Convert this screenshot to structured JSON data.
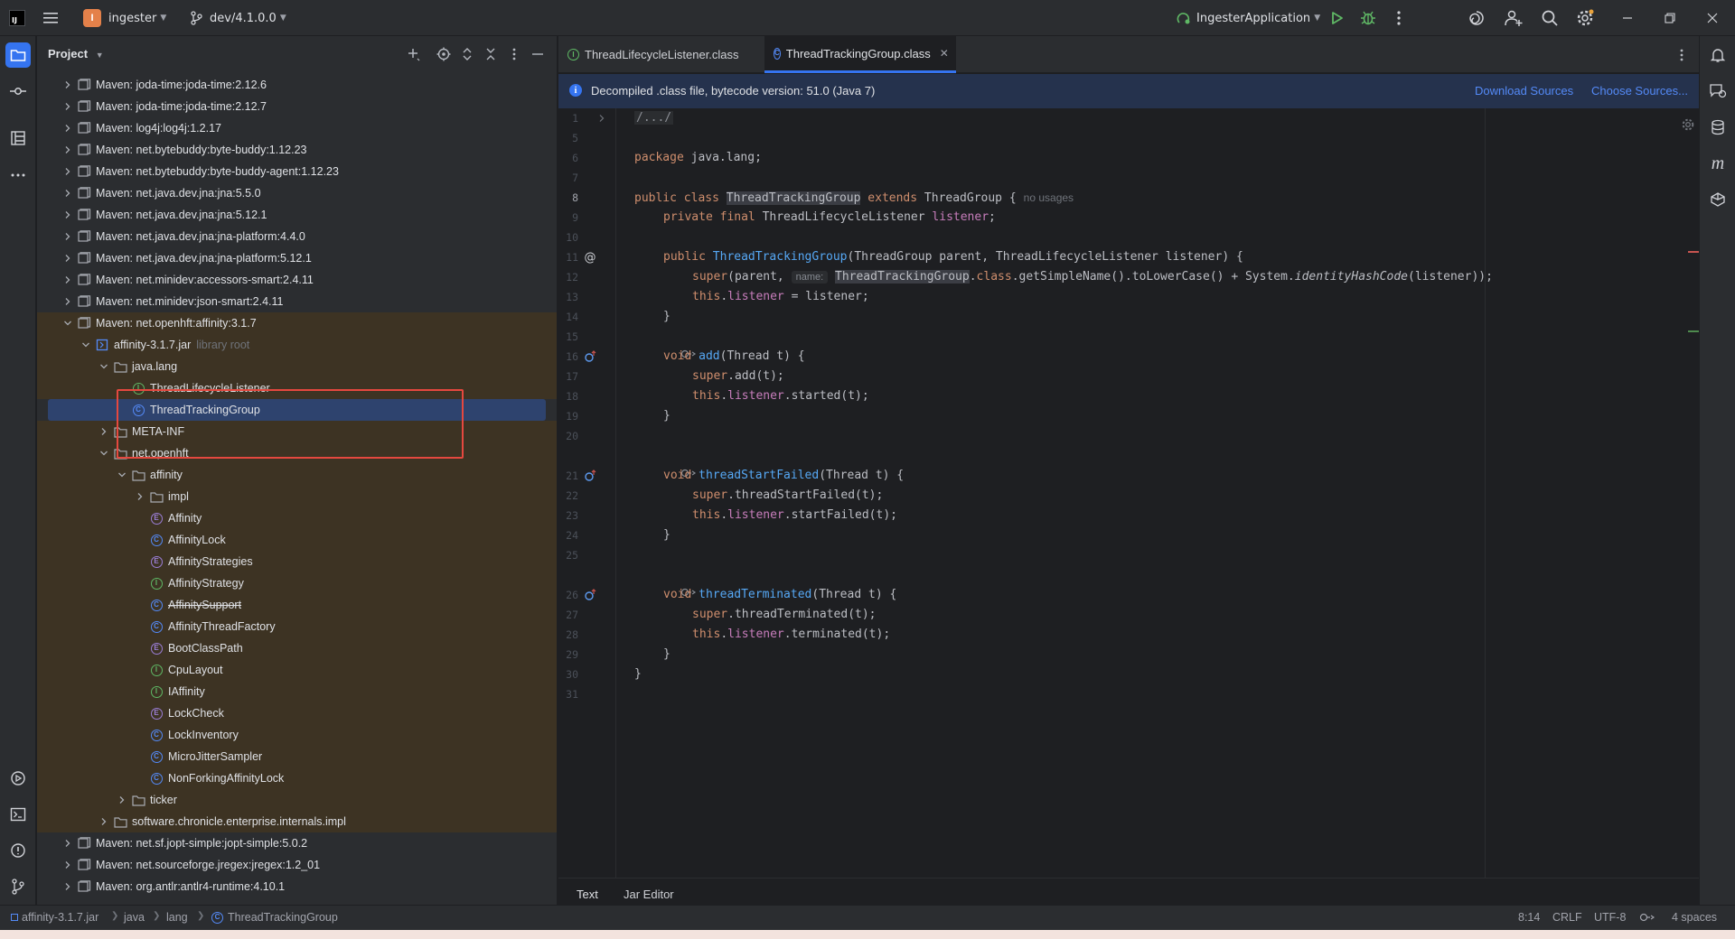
{
  "titlebar": {
    "project_badge": "I",
    "project_name": "ingester",
    "branch": "dev/4.1.0.0",
    "run_config": "IngesterApplication"
  },
  "project_panel": {
    "title": "Project",
    "tree": [
      {
        "label": "Maven: joda-time:joda-time:2.12.6",
        "icon": "library-icon",
        "depth": 0,
        "arrow": "collapsed"
      },
      {
        "label": "Maven: joda-time:joda-time:2.12.7",
        "icon": "library-icon",
        "depth": 0,
        "arrow": "collapsed"
      },
      {
        "label": "Maven: log4j:log4j:1.2.17",
        "icon": "library-icon",
        "depth": 0,
        "arrow": "collapsed"
      },
      {
        "label": "Maven: net.bytebuddy:byte-buddy:1.12.23",
        "icon": "library-icon",
        "depth": 0,
        "arrow": "collapsed"
      },
      {
        "label": "Maven: net.bytebuddy:byte-buddy-agent:1.12.23",
        "icon": "library-icon",
        "depth": 0,
        "arrow": "collapsed"
      },
      {
        "label": "Maven: net.java.dev.jna:jna:5.5.0",
        "icon": "library-icon",
        "depth": 0,
        "arrow": "collapsed"
      },
      {
        "label": "Maven: net.java.dev.jna:jna:5.12.1",
        "icon": "library-icon",
        "depth": 0,
        "arrow": "collapsed"
      },
      {
        "label": "Maven: net.java.dev.jna:jna-platform:4.4.0",
        "icon": "library-icon",
        "depth": 0,
        "arrow": "collapsed"
      },
      {
        "label": "Maven: net.java.dev.jna:jna-platform:5.12.1",
        "icon": "library-icon",
        "depth": 0,
        "arrow": "collapsed"
      },
      {
        "label": "Maven: net.minidev:accessors-smart:2.4.11",
        "icon": "library-icon",
        "depth": 0,
        "arrow": "collapsed"
      },
      {
        "label": "Maven: net.minidev:json-smart:2.4.11",
        "icon": "library-icon",
        "depth": 0,
        "arrow": "collapsed"
      },
      {
        "label": "Maven: net.openhft:affinity:3.1.7",
        "icon": "library-icon",
        "depth": 0,
        "arrow": "expanded",
        "lib": true
      },
      {
        "label": "affinity-3.1.7.jar",
        "hint": "library root",
        "icon": "jar-icon",
        "depth": 1,
        "arrow": "expanded",
        "lib": true
      },
      {
        "label": "java.lang",
        "icon": "package-icon",
        "depth": 2,
        "arrow": "expanded",
        "lib": true
      },
      {
        "label": "ThreadLifecycleListener",
        "icon": "interface-icon",
        "depth": 3,
        "arrow": "none",
        "lib": true
      },
      {
        "label": "ThreadTrackingGroup",
        "icon": "class-icon",
        "depth": 3,
        "arrow": "none",
        "lib": true,
        "selected": true
      },
      {
        "label": "META-INF",
        "icon": "folder-icon",
        "depth": 2,
        "arrow": "collapsed",
        "lib": true
      },
      {
        "label": "net.openhft",
        "icon": "package-icon",
        "depth": 2,
        "arrow": "expanded",
        "lib": true
      },
      {
        "label": "affinity",
        "icon": "package-icon",
        "depth": 3,
        "arrow": "expanded",
        "lib": true
      },
      {
        "label": "impl",
        "icon": "package-icon",
        "depth": 4,
        "arrow": "collapsed",
        "lib": true
      },
      {
        "label": "Affinity",
        "icon": "enum-icon",
        "depth": 4,
        "arrow": "none",
        "lib": true
      },
      {
        "label": "AffinityLock",
        "icon": "class-icon",
        "depth": 4,
        "arrow": "none",
        "lib": true
      },
      {
        "label": "AffinityStrategies",
        "icon": "enum-icon",
        "depth": 4,
        "arrow": "none",
        "lib": true
      },
      {
        "label": "AffinityStrategy",
        "icon": "interface-icon",
        "depth": 4,
        "arrow": "none",
        "lib": true
      },
      {
        "label": "AffinitySupport",
        "icon": "class-icon",
        "depth": 4,
        "arrow": "none",
        "lib": true,
        "strike": true
      },
      {
        "label": "AffinityThreadFactory",
        "icon": "class-icon",
        "depth": 4,
        "arrow": "none",
        "lib": true
      },
      {
        "label": "BootClassPath",
        "icon": "enum-icon",
        "depth": 4,
        "arrow": "none",
        "lib": true
      },
      {
        "label": "CpuLayout",
        "icon": "interface-icon",
        "depth": 4,
        "arrow": "none",
        "lib": true
      },
      {
        "label": "IAffinity",
        "icon": "interface-icon",
        "depth": 4,
        "arrow": "none",
        "lib": true
      },
      {
        "label": "LockCheck",
        "icon": "enum-icon",
        "depth": 4,
        "arrow": "none",
        "lib": true
      },
      {
        "label": "LockInventory",
        "icon": "class-icon",
        "depth": 4,
        "arrow": "none",
        "lib": true
      },
      {
        "label": "MicroJitterSampler",
        "icon": "class-icon",
        "depth": 4,
        "arrow": "none",
        "lib": true
      },
      {
        "label": "NonForkingAffinityLock",
        "icon": "class-icon",
        "depth": 4,
        "arrow": "none",
        "lib": true
      },
      {
        "label": "ticker",
        "icon": "package-icon",
        "depth": 3,
        "arrow": "collapsed",
        "lib": true
      },
      {
        "label": "software.chronicle.enterprise.internals.impl",
        "icon": "package-icon",
        "depth": 2,
        "arrow": "collapsed",
        "lib": true
      },
      {
        "label": "Maven: net.sf.jopt-simple:jopt-simple:5.0.2",
        "icon": "library-icon",
        "depth": 0,
        "arrow": "collapsed"
      },
      {
        "label": "Maven: net.sourceforge.jregex:jregex:1.2_01",
        "icon": "library-icon",
        "depth": 0,
        "arrow": "collapsed"
      },
      {
        "label": "Maven: org.antlr:antlr4-runtime:4.10.1",
        "icon": "library-icon",
        "depth": 0,
        "arrow": "collapsed"
      }
    ]
  },
  "editor": {
    "tabs": [
      {
        "label": "ThreadLifecycleListener.class",
        "icon": "interface-icon",
        "active": false
      },
      {
        "label": "ThreadTrackingGroup.class",
        "icon": "class-icon",
        "active": true
      }
    ],
    "notice": {
      "text": "Decompiled .class file, bytecode version: 51.0 (Java 7)",
      "download_sources": "Download Sources",
      "choose_sources": "Choose Sources..."
    },
    "line_numbers": [
      "1",
      "5",
      "6",
      "7",
      "8",
      "9",
      "10",
      "11",
      "12",
      "13",
      "14",
      "15",
      "16",
      "17",
      "18",
      "19",
      "20",
      "21",
      "22",
      "23",
      "24",
      "25",
      "26",
      "27",
      "28",
      "29",
      "30",
      "31"
    ],
    "current_line": "8",
    "code": {
      "l1": "/.../",
      "l6_kw": "package",
      "l6_rest": " java.lang;",
      "l8_kw1": "public class",
      "l8_cls": "ThreadTrackingGroup",
      "l8_kw2": "extends",
      "l8_rest": " ThreadGroup {",
      "l8_hint": "no usages",
      "l9_kw": "private final",
      "l9_type": " ThreadLifecycleListener ",
      "l9_fld": "listener",
      "l9_end": ";",
      "l11_kw": "public",
      "l11_fn": "ThreadTrackingGroup",
      "l11_rest": "(ThreadGroup parent, ThreadLifecycleListener listener) {",
      "l12_kw": "super",
      "l12_a": "(parent, ",
      "l12_hint": "name:",
      "l12_cls": "ThreadTrackingGroup",
      "l12_dot": ".",
      "l12_kw2": "class",
      "l12_b": ".getSimpleName().toLowerCase() + System.",
      "l12_it": "identityHashCode",
      "l12_c": "(listener));",
      "l13_kw": "this",
      "l13_dot": ".",
      "l13_fld": "listener",
      "l13_rest": " = listener;",
      "close": "}",
      "l16_kw": "void",
      "l16_fn": "add",
      "l16_rest": "(Thread t) {",
      "l17_kw": "super",
      "l17_rest": ".add(t);",
      "l18_kw": "this",
      "l18_fld": "listener",
      "l18_rest": ".started(t);",
      "l21_fn": "threadStartFailed",
      "l22_rest": ".threadStartFailed(t);",
      "l23_rest": ".startFailed(t);",
      "l26_fn": "threadTerminated",
      "l27_rest": ".threadTerminated(t);",
      "l28_rest": ".terminated(t);"
    },
    "bottom_tabs": {
      "text": "Text",
      "jar_editor": "Jar Editor"
    }
  },
  "statusbar": {
    "crumbs": [
      "affinity-3.1.7.jar",
      "java",
      "lang",
      "ThreadTrackingGroup"
    ],
    "position": "8:14",
    "line_sep": "CRLF",
    "encoding": "UTF-8",
    "indent": "4 spaces"
  },
  "colors": {
    "accent": "#3574f0",
    "library_bg": "#3d3323",
    "selection_bg": "#2e436e",
    "highlight_box": "#e5483f",
    "keyword": "#cf8e6d",
    "function": "#56a8f5",
    "field": "#c77dbb"
  }
}
